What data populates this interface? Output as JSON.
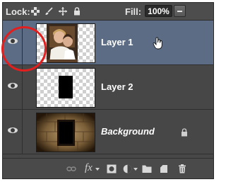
{
  "panel": {
    "lock_label": "Lock:",
    "lock_icons": [
      "lock-transparent-pixels-icon",
      "lock-image-pixels-icon",
      "lock-position-icon",
      "lock-all-icon"
    ],
    "fill_label": "Fill:",
    "fill_value": "100%"
  },
  "layers": [
    {
      "name": "Layer 1",
      "selected": true,
      "visible": true
    },
    {
      "name": "Layer 2",
      "selected": false,
      "visible": true
    },
    {
      "name": "Background",
      "selected": false,
      "visible": true,
      "locked": true
    }
  ],
  "footer_icons": [
    "link-layers-icon",
    "fx-icon",
    "layer-mask-icon",
    "adjustment-layer-icon",
    "new-group-icon",
    "new-layer-icon",
    "trash-icon"
  ],
  "footer": {
    "fx_label": "fx"
  },
  "colors": {
    "selected_row": "#5b6c84",
    "highlight_circle": "#e21f1f"
  }
}
